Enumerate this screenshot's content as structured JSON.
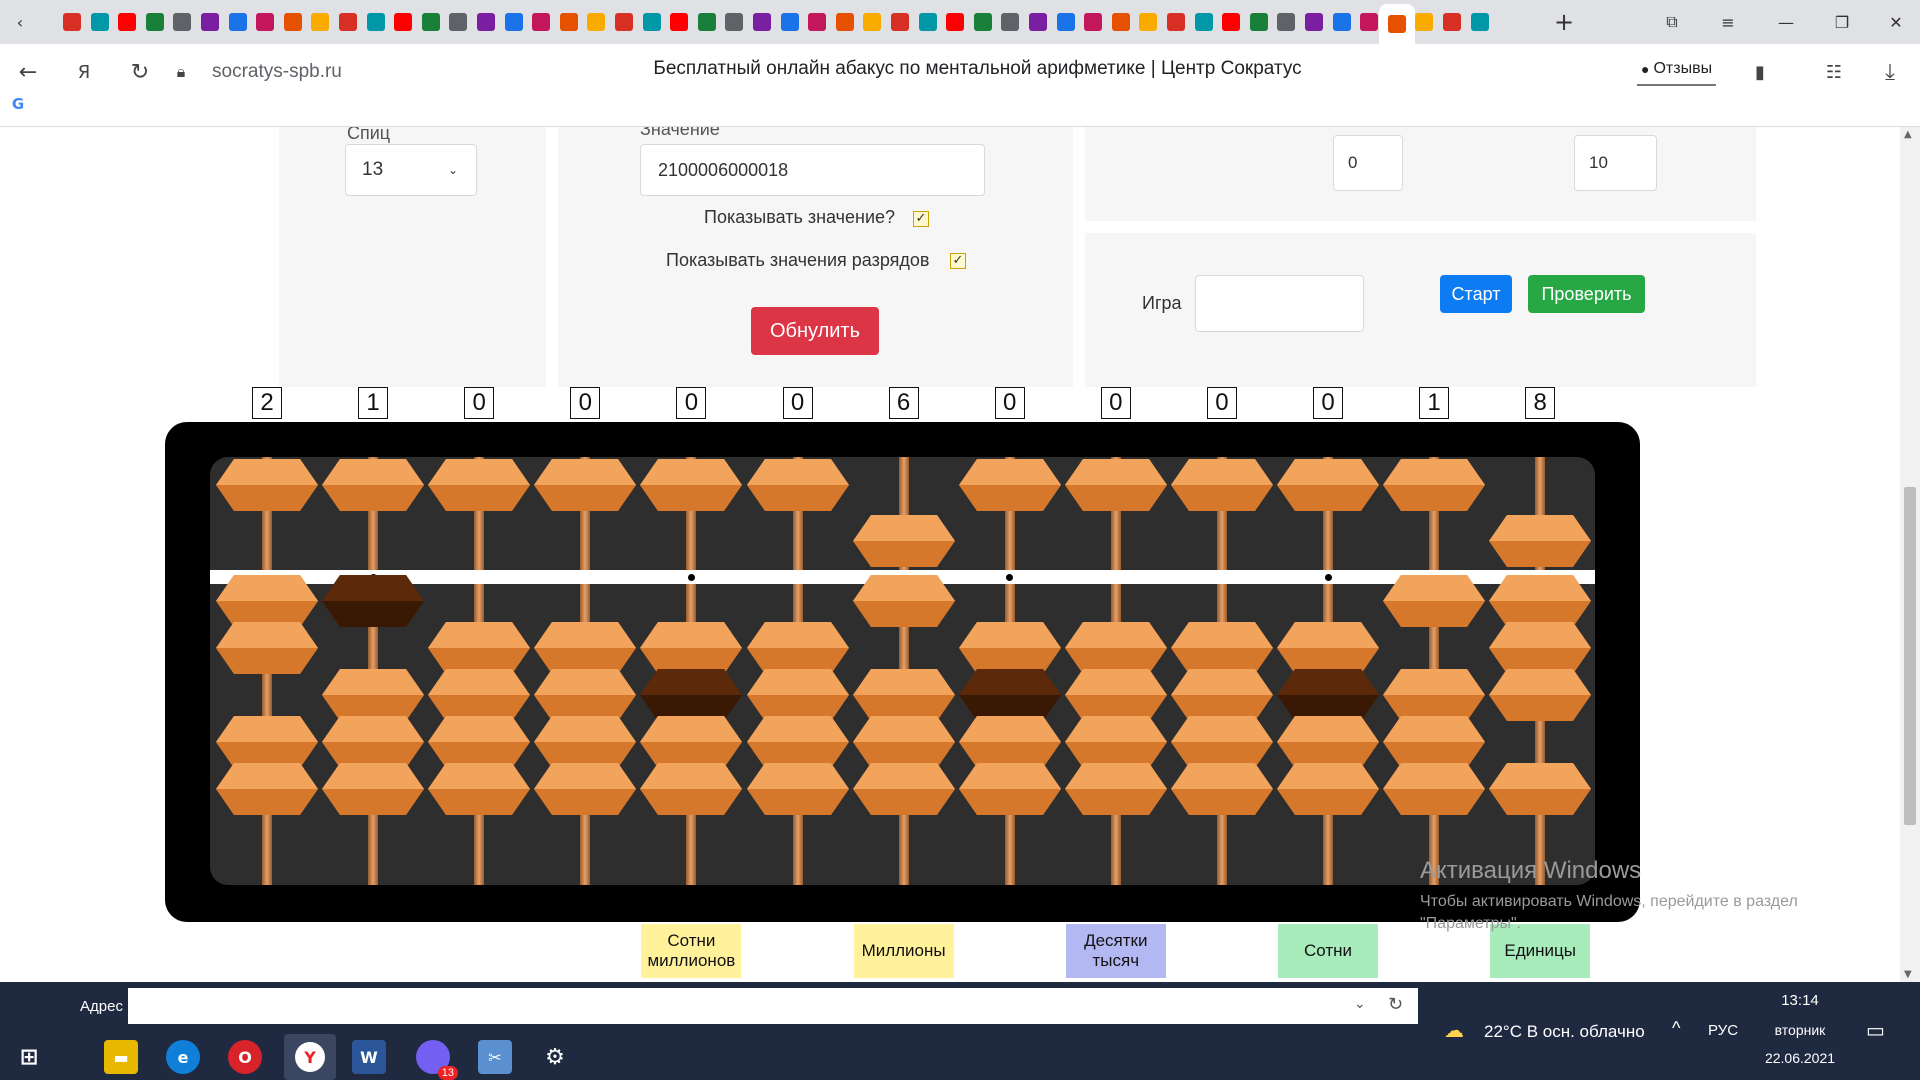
{
  "browser": {
    "url": "socratys-spb.ru",
    "page_title": "Бесплатный онлайн абакус по ментальной арифметике | Центр Сократус",
    "reviews_label": "Отзывы",
    "tab_count": 52
  },
  "form": {
    "digits_label_partial": "Спиц",
    "digits_value": "13",
    "value_label_partial": "Значение",
    "value": "2100006000018",
    "show_value_label": "Показывать значение?",
    "show_value_checked": true,
    "show_digits_label": "Показывать значения разрядов",
    "show_digits_checked": true,
    "reset_button": "Обнулить",
    "range_from": "0",
    "range_to": "10",
    "game_label": "Игра",
    "game_value": "",
    "start_button": "Старт",
    "check_button": "Проверить"
  },
  "abacus": {
    "digits": [
      "2",
      "1",
      "0",
      "0",
      "0",
      "0",
      "6",
      "0",
      "0",
      "0",
      "0",
      "1",
      "8"
    ],
    "rod_count": 13,
    "beam_dot_rods": [
      1,
      4,
      7,
      10
    ],
    "highlighted_lower": [
      {
        "rod": 1,
        "bead": 0
      },
      {
        "rod": 4,
        "bead": 1
      },
      {
        "rod": 7,
        "bead": 1
      },
      {
        "rod": 10,
        "bead": 1
      }
    ]
  },
  "place_labels": [
    {
      "text": "Сотни миллионов",
      "rod": 4,
      "color": "#fff29a"
    },
    {
      "text": "Миллионы",
      "rod": 6,
      "color": "#fff29a"
    },
    {
      "text": "Десятки тысяч",
      "rod": 8,
      "color": "#b3b7f2"
    },
    {
      "text": "Сотни",
      "rod": 10,
      "color": "#a8ecbc"
    },
    {
      "text": "Единицы",
      "rod": 12,
      "color": "#a8ecbc"
    }
  ],
  "watermark": {
    "title": "Активация Windows",
    "line1": "Чтобы активировать Windows, перейдите в раздел",
    "line2": "\"Параметры\"."
  },
  "taskbar": {
    "address_label": "Адрес",
    "weather": "22°C  В осн. облачно",
    "lang": "РУС",
    "time": "13:14",
    "weekday": "вторник",
    "date": "22.06.2021",
    "viber_badge": "13"
  },
  "colors": {
    "bead": "#e8893a",
    "bead_dark": "#4a2106",
    "blue_button": "#0d7cf2",
    "green_button": "#28a745",
    "red_button": "#dc3545"
  }
}
